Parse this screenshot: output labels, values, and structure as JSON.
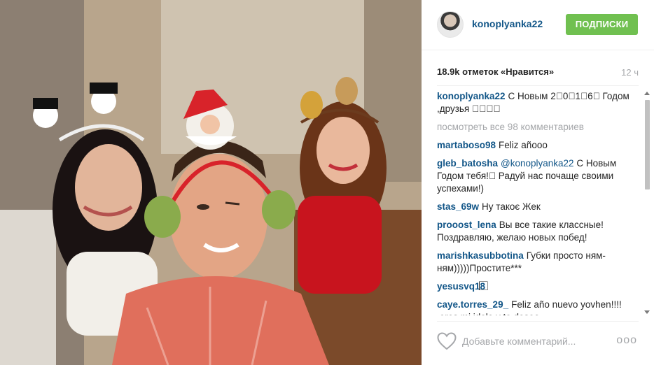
{
  "post": {
    "username": "konoplyanka22",
    "follow_label": "ПОДПИСКИ",
    "likes": "18.9k отметок «Нравится»",
    "time_ago": "12 ч",
    "view_all": "посмотреть все 98 комментариев",
    "comment_placeholder": "Добавьте комментарий...",
    "more_dots": "ооо"
  },
  "caption": {
    "user": "konoplyanka22",
    "text": "С Новым 2⃞0⃞1⃞6⃞ Годом ,друзья ⃞⃞⃞⃞"
  },
  "comments": [
    {
      "user": "martaboso98",
      "text": "Feliz añooo"
    },
    {
      "user": "gleb_batosha",
      "mention": "@konoplyanka22",
      "text": " С Новым Годом тебя!⃞ Радуй нас почаще своими успехами!)"
    },
    {
      "user": "stas_69w",
      "text": "Ну такоє Жек"
    },
    {
      "user": "prooost_lena",
      "text": "Вы все такие классные! Поздравляю, желаю новых побед!"
    },
    {
      "user": "marishkasubbotina",
      "text": "Губки просто ням-ням)))))Простите***"
    },
    {
      "user": "yesusvq18",
      "text": "⃞⃞⃞⃞⃞"
    },
    {
      "user": "caye.torres_29_",
      "text": "Feliz año nuevo yovhen!!!! ⃞⃞⃞ eres mi idolo y te deseo"
    }
  ],
  "colors": {
    "username": "#125688",
    "follow_button": "#70c050",
    "muted": "#a5a7aa",
    "text": "#262626"
  },
  "icons": {
    "like": "heart-icon",
    "options": "more-options-icon"
  }
}
